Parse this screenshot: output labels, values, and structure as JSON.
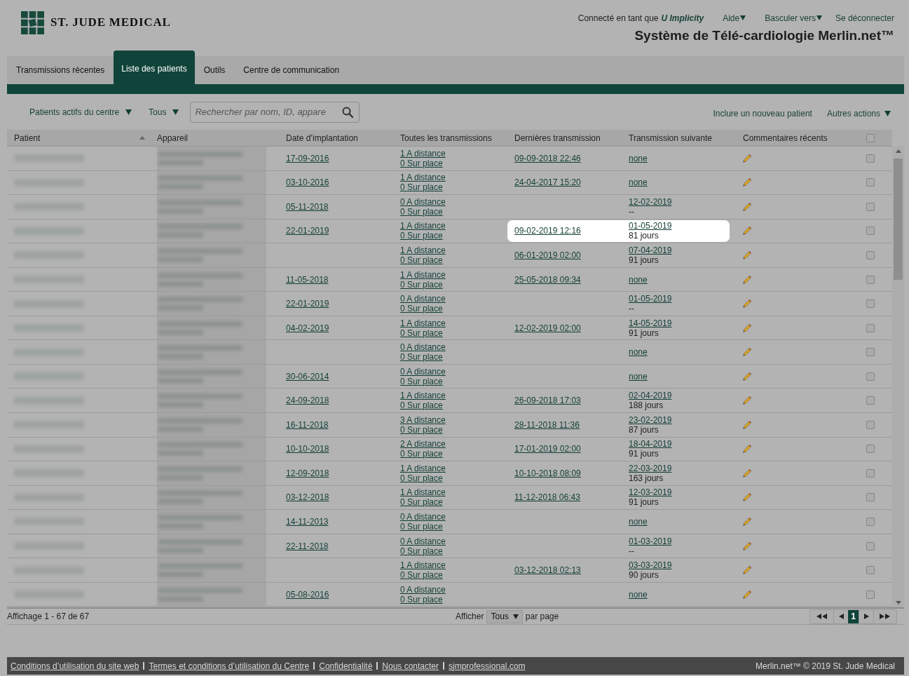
{
  "header": {
    "logo_text": "ST. JUDE MEDICAL",
    "user": {
      "label": "Connecté en tant que",
      "name": "U Implicity"
    },
    "links": [
      {
        "label": "Aide",
        "kind": "menu"
      },
      {
        "label": "Basculer vers",
        "kind": "menu"
      },
      {
        "label": "Se déconnecter",
        "kind": "link"
      }
    ],
    "title": "Système de Télé-cardiologie Merlin.net™"
  },
  "tabs": [
    {
      "label": "Transmissions récentes",
      "selected": false
    },
    {
      "label": "Liste des patients",
      "selected": true
    },
    {
      "label": "Outils",
      "selected": false
    },
    {
      "label": "Centre de communication",
      "selected": false
    }
  ],
  "toolbar": {
    "filters": [
      {
        "label": "Patients actifs du centre"
      },
      {
        "label": "Tous"
      }
    ],
    "search": {
      "placeholder": "Rechercher par nom, ID, appare"
    },
    "actions": [
      {
        "label": "Inclure un nouveau patient",
        "kind": "link"
      },
      {
        "label": "Autres actions",
        "kind": "menu"
      }
    ]
  },
  "table": {
    "columns": [
      {
        "kind": "text",
        "label": "Patient",
        "sorted_ascending": true
      },
      {
        "kind": "text",
        "label": "Appareil"
      },
      {
        "kind": "text",
        "label": "Date d’implantation"
      },
      {
        "kind": "text",
        "label": "Toutes les transmissions"
      },
      {
        "kind": "text",
        "label": "Dernières transmission"
      },
      {
        "kind": "text",
        "label": "Transmission suivante"
      },
      {
        "kind": "text",
        "label": "Commentaires récents"
      },
      {
        "kind": "checkbox",
        "checked": false
      }
    ],
    "rows": [
      {
        "implant_date": "17-09-2016",
        "transmissions": {
          "remote": "1 A distance",
          "onsite": "0 Sur place"
        },
        "last": "09-09-2018 22:46",
        "next": {
          "date": "none"
        },
        "highlighted": false,
        "checked": false
      },
      {
        "implant_date": "03-10-2016",
        "transmissions": {
          "remote": "1 A distance",
          "onsite": "0 Sur place"
        },
        "last": "24-04-2017 15:20",
        "next": {
          "date": "none"
        },
        "highlighted": false,
        "checked": false
      },
      {
        "implant_date": "05-11-2018",
        "transmissions": {
          "remote": "0 A distance",
          "onsite": "0 Sur place"
        },
        "next": {
          "date": "12-02-2019",
          "note": "--"
        },
        "highlighted": false,
        "checked": false
      },
      {
        "implant_date": "22-01-2019",
        "transmissions": {
          "remote": "1 A distance",
          "onsite": "0 Sur place"
        },
        "last": "09-02-2019 12:16",
        "next": {
          "date": "01-05-2019",
          "note": "81 jours"
        },
        "highlighted": true,
        "checked": false
      },
      {
        "transmissions": {
          "remote": "1 A distance",
          "onsite": "0 Sur place"
        },
        "last": "06-01-2019 02:00",
        "next": {
          "date": "07-04-2019",
          "note": "91 jours"
        },
        "highlighted": false,
        "checked": false
      },
      {
        "implant_date": "11-05-2018",
        "transmissions": {
          "remote": "1 A distance",
          "onsite": "0 Sur place"
        },
        "last": "25-05-2018 09:34",
        "next": {
          "date": "none"
        },
        "highlighted": false,
        "checked": false
      },
      {
        "implant_date": "22-01-2019",
        "transmissions": {
          "remote": "0 A distance",
          "onsite": "0 Sur place"
        },
        "next": {
          "date": "01-05-2019",
          "note": "--"
        },
        "highlighted": false,
        "checked": false
      },
      {
        "implant_date": "04-02-2019",
        "transmissions": {
          "remote": "1 A distance",
          "onsite": "0 Sur place"
        },
        "last": "12-02-2019 02:00",
        "next": {
          "date": "14-05-2019",
          "note": "91 jours"
        },
        "highlighted": false,
        "checked": false
      },
      {
        "transmissions": {
          "remote": "0 A distance",
          "onsite": "0 Sur place"
        },
        "next": {
          "date": "none"
        },
        "highlighted": false,
        "checked": false
      },
      {
        "implant_date": "30-06-2014",
        "transmissions": {
          "remote": "0 A distance",
          "onsite": "0 Sur place"
        },
        "next": {
          "date": "none"
        },
        "highlighted": false,
        "checked": false
      },
      {
        "implant_date": "24-09-2018",
        "transmissions": {
          "remote": "1 A distance",
          "onsite": "0 Sur place"
        },
        "last": "26-09-2018 17:03",
        "next": {
          "date": "02-04-2019",
          "note": "188 jours"
        },
        "highlighted": false,
        "checked": false
      },
      {
        "implant_date": "16-11-2018",
        "transmissions": {
          "remote": "3 A distance",
          "onsite": "0 Sur place"
        },
        "last": "28-11-2018 11:36",
        "next": {
          "date": "23-02-2019",
          "note": "87 jours"
        },
        "highlighted": false,
        "checked": false
      },
      {
        "implant_date": "10-10-2018",
        "transmissions": {
          "remote": "2 A distance",
          "onsite": "0 Sur place"
        },
        "last": "17-01-2019 02:00",
        "next": {
          "date": "18-04-2019",
          "note": "91 jours"
        },
        "highlighted": false,
        "checked": false
      },
      {
        "implant_date": "12-09-2018",
        "transmissions": {
          "remote": "1 A distance",
          "onsite": "0 Sur place"
        },
        "last": "10-10-2018 08:09",
        "next": {
          "date": "22-03-2019",
          "note": "163 jours"
        },
        "highlighted": false,
        "checked": false
      },
      {
        "implant_date": "03-12-2018",
        "transmissions": {
          "remote": "1 A distance",
          "onsite": "0 Sur place"
        },
        "last": "11-12-2018 06:43",
        "next": {
          "date": "12-03-2019",
          "note": "91 jours"
        },
        "highlighted": false,
        "checked": false
      },
      {
        "implant_date": "14-11-2013",
        "transmissions": {
          "remote": "0 A distance",
          "onsite": "0 Sur place"
        },
        "next": {
          "date": "none"
        },
        "highlighted": false,
        "checked": false
      },
      {
        "implant_date": "22-11-2018",
        "transmissions": {
          "remote": "0 A distance",
          "onsite": "0 Sur place"
        },
        "next": {
          "date": "01-03-2019",
          "note": "--"
        },
        "highlighted": false,
        "checked": false
      },
      {
        "transmissions": {
          "remote": "1 A distance",
          "onsite": "0 Sur place"
        },
        "last": "03-12-2018 02:13",
        "next": {
          "date": "03-03-2019",
          "note": "90 jours"
        },
        "highlighted": false,
        "checked": false
      },
      {
        "implant_date": "05-08-2016",
        "transmissions": {
          "remote": "0 A distance",
          "onsite": "0 Sur place"
        },
        "next": {
          "date": "none"
        },
        "highlighted": false,
        "checked": false
      }
    ]
  },
  "status": {
    "summary": "Affichage 1 - 67 de 67",
    "page_size": {
      "before": "Afficher",
      "value": "Tous",
      "after": "par page"
    },
    "pages": [
      {
        "label": "1",
        "selected": true
      }
    ]
  },
  "footer": {
    "links": [
      "Conditions d’utilisation du site web",
      "Termes et conditions d’utilisation du Centre",
      "Confidentialité",
      "Nous contacter",
      "sjmprofessional.com"
    ],
    "copyright": "Merlin.net™ © 2019 St. Jude Medical"
  }
}
